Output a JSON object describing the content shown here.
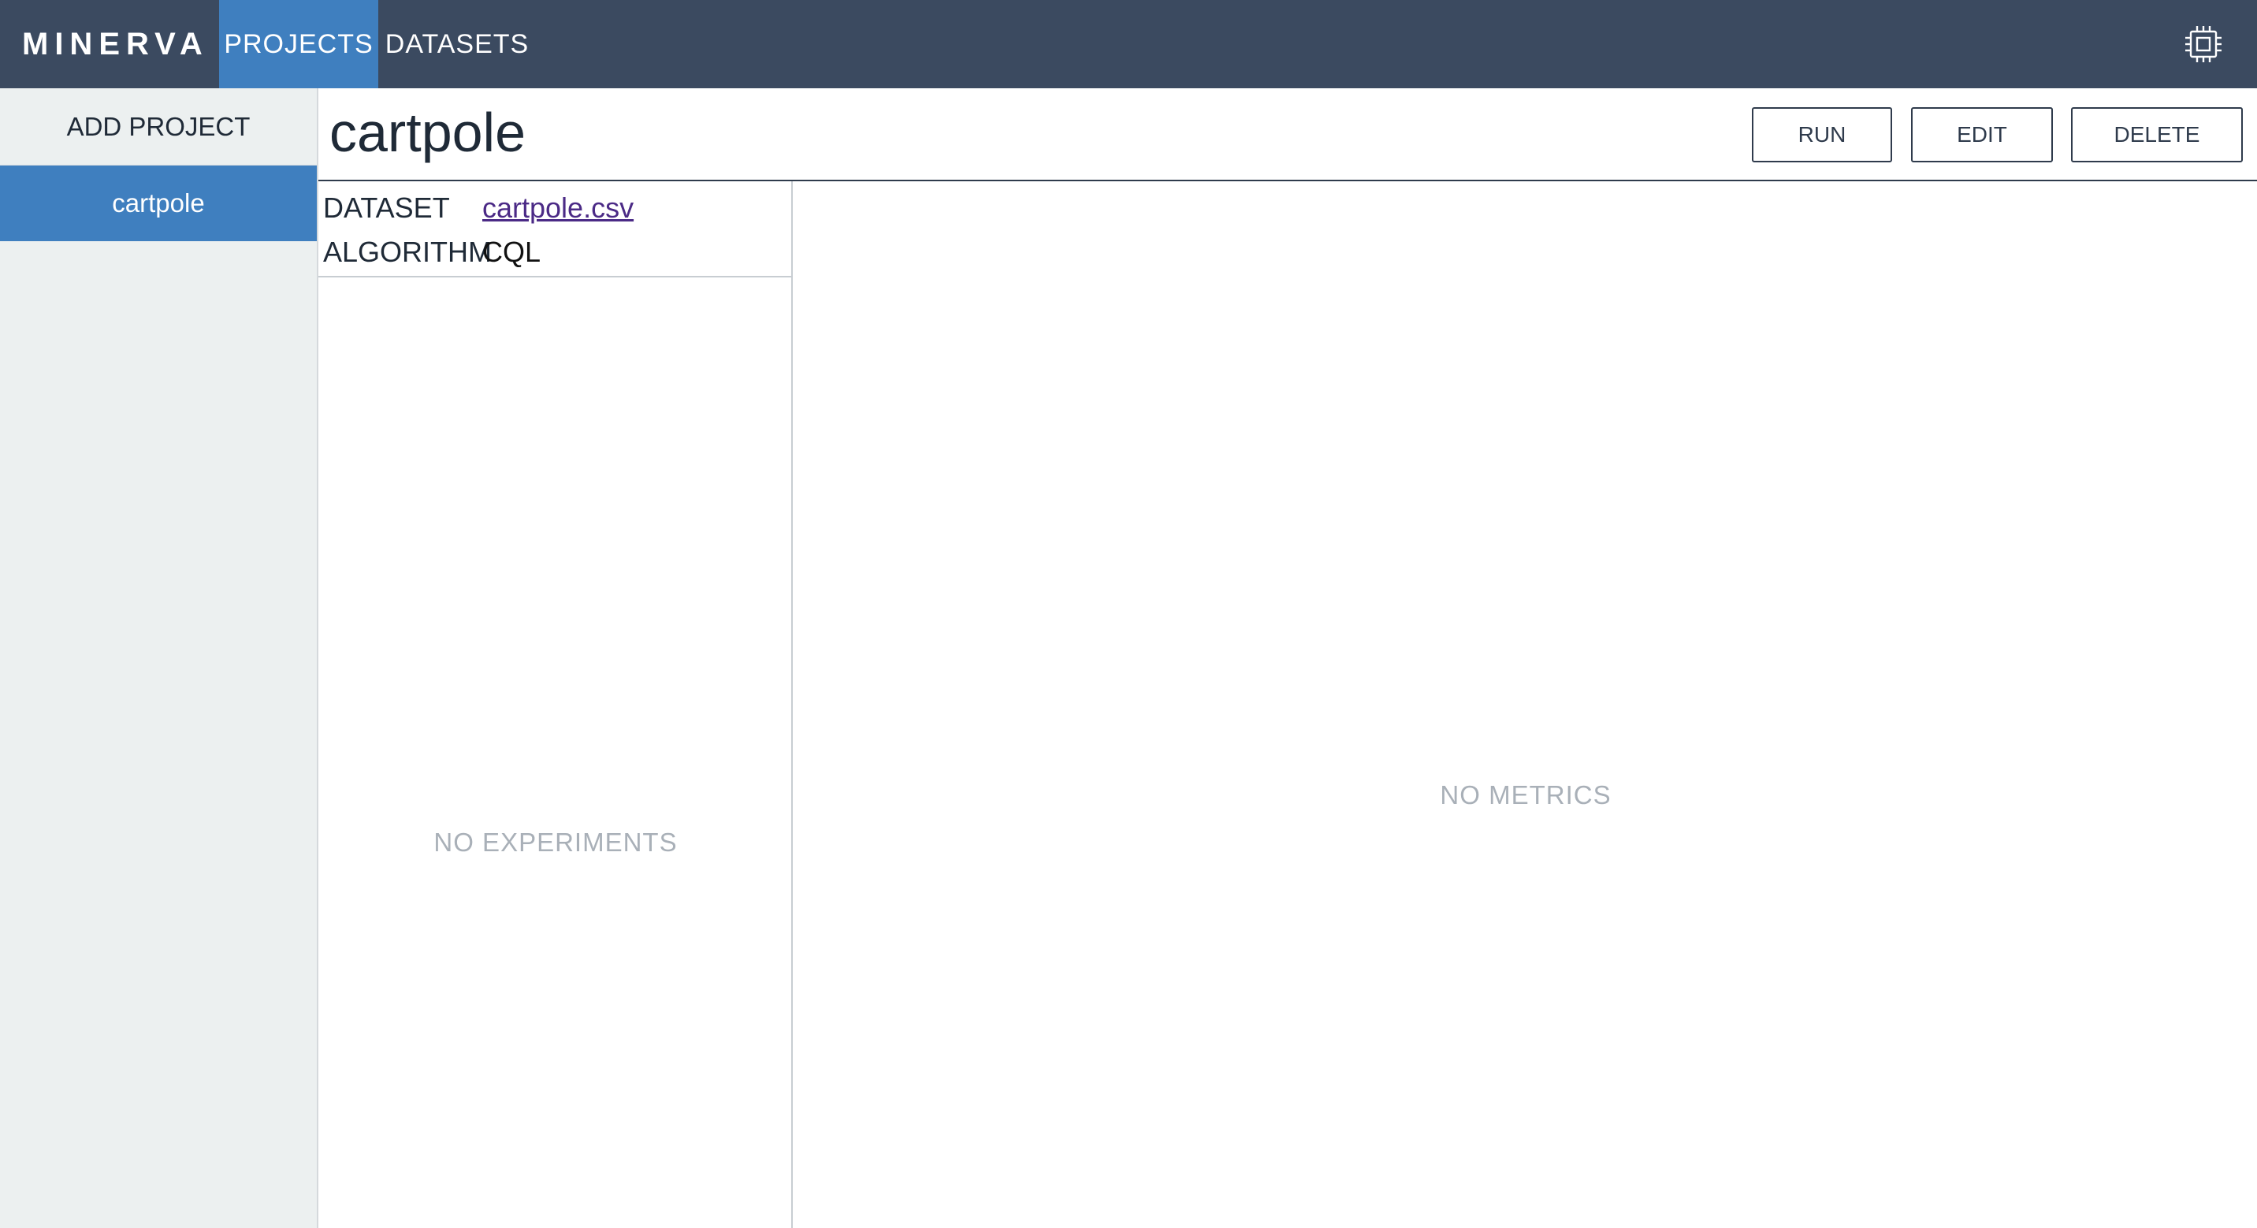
{
  "app": {
    "brand": "MINERVA"
  },
  "nav": {
    "tabs": [
      {
        "label": "PROJECTS",
        "active": true
      },
      {
        "label": "DATASETS",
        "active": false
      }
    ],
    "settings_icon": "cpu-chip-icon"
  },
  "sidebar": {
    "add_label": "ADD PROJECT",
    "items": [
      {
        "label": "cartpole",
        "selected": true
      }
    ]
  },
  "project": {
    "title": "cartpole",
    "actions": {
      "run": "RUN",
      "edit": "EDIT",
      "delete": "DELETE"
    },
    "info": {
      "dataset_key": "DATASET",
      "dataset_value": "cartpole.csv",
      "algorithm_key": "ALGORITHM",
      "algorithm_value": "CQL"
    },
    "experiments_empty": "NO EXPERIMENTS",
    "metrics_empty": "NO METRICS"
  },
  "colors": {
    "header_bg": "#3b4a60",
    "accent": "#3f7fbf",
    "sidebar_bg": "#ecf0f0",
    "link": "#4b2a86",
    "muted_text": "#a9b0b8"
  }
}
